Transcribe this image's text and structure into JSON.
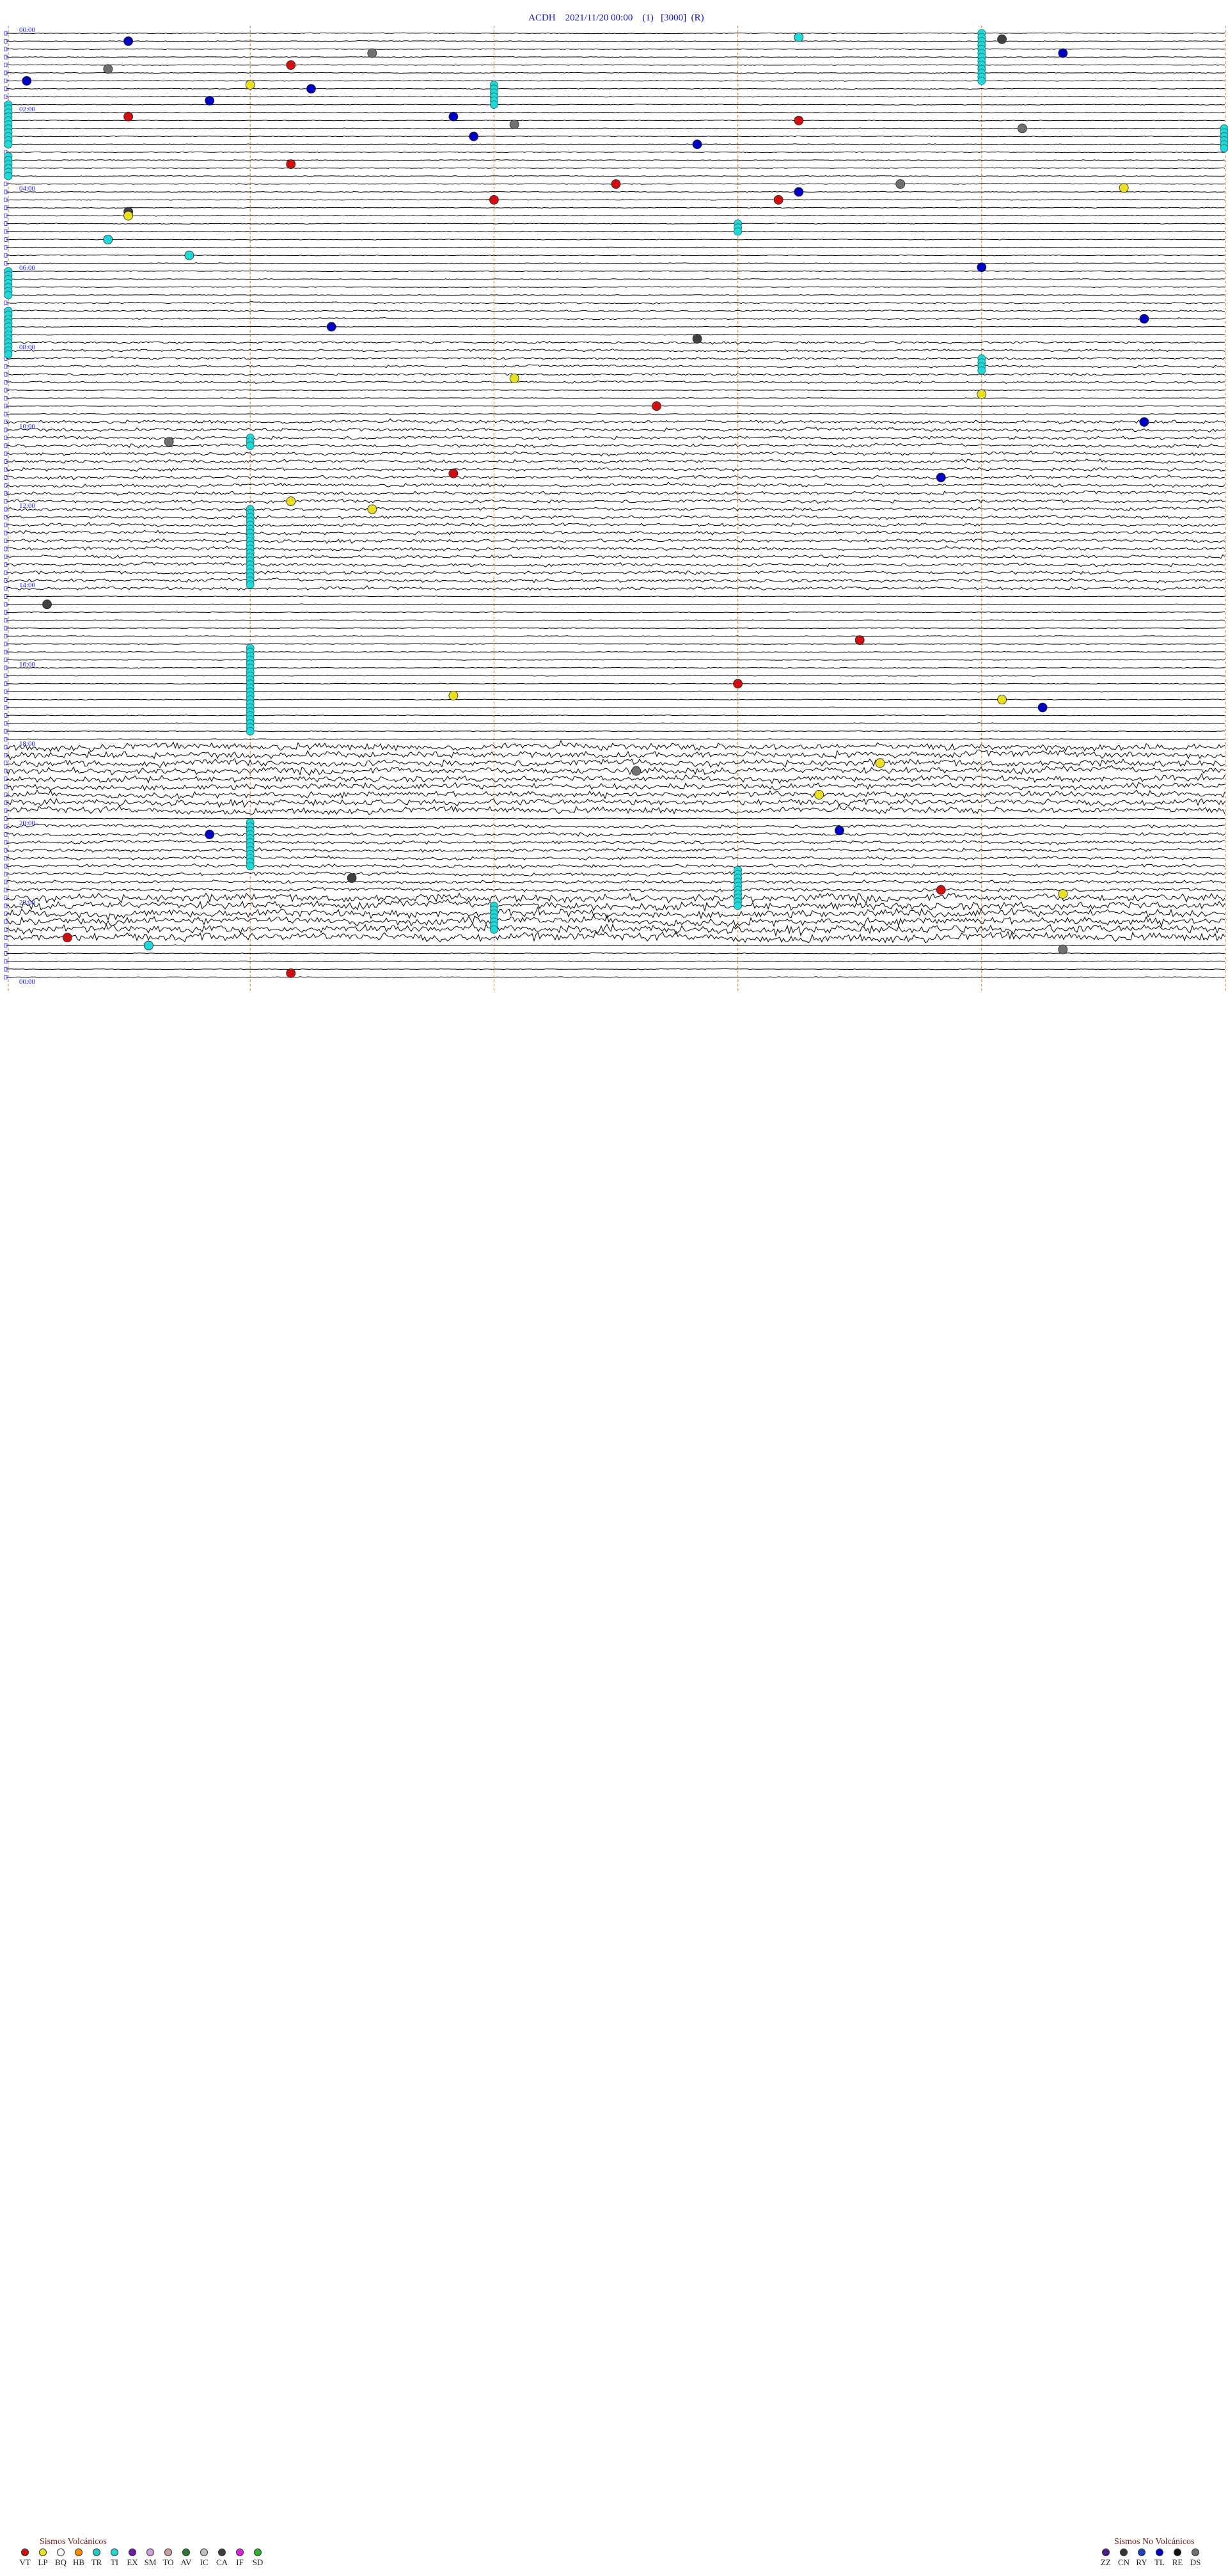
{
  "header": {
    "station": "ACDH",
    "datetime": "2021/11/20 00:00",
    "param1": "(1)",
    "param2": "[3000]",
    "param3": "(R)"
  },
  "chart_data": {
    "type": "helicorder",
    "rows_per_hour": 5,
    "hours_shown": 24,
    "hour_labels": [
      "00:00",
      "02:00",
      "04:00",
      "06:00",
      "08:00",
      "10:00",
      "12:00",
      "14:00",
      "16:00",
      "18:00",
      "20:00",
      "22:00",
      "00:00"
    ],
    "colors": {
      "trace": "#000000",
      "label": "#1a1aff",
      "gridline": "#d98c5f",
      "VT": "#d01010",
      "LP": "#e8e020",
      "BQ": "#ffffff",
      "HB": "#ff8c00",
      "TR": "#20c8c8",
      "TI": "#20d8d8",
      "EX": "#6a1ab0",
      "SM": "#d0a0e0",
      "TO": "#c8a0a0",
      "AV": "#2a7a2a",
      "IC": "#c0c0c0",
      "CA": "#404040",
      "IF": "#e020e0",
      "SD": "#30b030",
      "ZZ": "#4b1d8a",
      "CN": "#333333",
      "RY": "#2040c0",
      "TL": "#0000c0",
      "RE": "#101010",
      "DS": "#707070"
    },
    "events": [
      {
        "hour": 0.2,
        "minute": 6,
        "class": "TL"
      },
      {
        "hour": 0.1,
        "minute": 39,
        "class": "TI"
      },
      {
        "hour": 0.15,
        "minute": 49,
        "class": "CA"
      },
      {
        "hour": 0.5,
        "minute": 18,
        "class": "DS"
      },
      {
        "hour": 0.5,
        "minute": 52,
        "class": "TL"
      },
      {
        "hour": 0.8,
        "minute": 14,
        "class": "VT"
      },
      {
        "hour": 0.9,
        "minute": 5,
        "class": "DS"
      },
      {
        "hour": 1.2,
        "minute": 1,
        "class": "TL"
      },
      {
        "hour": 1.3,
        "minute": 12,
        "class": "LP"
      },
      {
        "hour": 1.4,
        "minute": 15,
        "class": "TL"
      },
      {
        "hour": 1.7,
        "minute": 10,
        "class": "TL"
      },
      {
        "hour": 2.1,
        "minute": 6,
        "class": "VT"
      },
      {
        "hour": 2.1,
        "minute": 22,
        "class": "TL"
      },
      {
        "hour": 2.2,
        "minute": 39,
        "class": "VT"
      },
      {
        "hour": 2.3,
        "minute": 25,
        "class": "DS"
      },
      {
        "hour": 2.4,
        "minute": 50,
        "class": "DS"
      },
      {
        "hour": 2.6,
        "minute": 23,
        "class": "TL"
      },
      {
        "hour": 2.8,
        "minute": 34,
        "class": "TL"
      },
      {
        "hour": 3.3,
        "minute": 14,
        "class": "VT"
      },
      {
        "hour": 3.8,
        "minute": 30,
        "class": "VT"
      },
      {
        "hour": 3.8,
        "minute": 44,
        "class": "DS"
      },
      {
        "hour": 3.9,
        "minute": 55,
        "class": "LP"
      },
      {
        "hour": 4.0,
        "minute": 39,
        "class": "TL"
      },
      {
        "hour": 4.2,
        "minute": 24,
        "class": "VT"
      },
      {
        "hour": 4.2,
        "minute": 38,
        "class": "VT"
      },
      {
        "hour": 4.5,
        "minute": 6,
        "class": "CA"
      },
      {
        "hour": 4.6,
        "minute": 6,
        "class": "LP"
      },
      {
        "hour": 5.2,
        "minute": 5,
        "class": "TI"
      },
      {
        "hour": 5.6,
        "minute": 9,
        "class": "TI"
      },
      {
        "hour": 5.9,
        "minute": 48,
        "class": "TL"
      },
      {
        "hour": 7.2,
        "minute": 56,
        "class": "TL"
      },
      {
        "hour": 7.4,
        "minute": 16,
        "class": "TL"
      },
      {
        "hour": 7.7,
        "minute": 34,
        "class": "CA"
      },
      {
        "hour": 8.7,
        "minute": 25,
        "class": "LP"
      },
      {
        "hour": 9.1,
        "minute": 48,
        "class": "LP"
      },
      {
        "hour": 9.4,
        "minute": 32,
        "class": "VT"
      },
      {
        "hour": 9.8,
        "minute": 56,
        "class": "TL"
      },
      {
        "hour": 10.3,
        "minute": 8,
        "class": "DS"
      },
      {
        "hour": 11.1,
        "minute": 22,
        "class": "VT"
      },
      {
        "hour": 11.2,
        "minute": 46,
        "class": "TL"
      },
      {
        "hour": 11.8,
        "minute": 14,
        "class": "LP"
      },
      {
        "hour": 12.0,
        "minute": 18,
        "class": "LP"
      },
      {
        "hour": 14.4,
        "minute": 2,
        "class": "CA"
      },
      {
        "hour": 15.3,
        "minute": 42,
        "class": "VT"
      },
      {
        "hour": 16.4,
        "minute": 36,
        "class": "VT"
      },
      {
        "hour": 16.7,
        "minute": 22,
        "class": "LP"
      },
      {
        "hour": 16.8,
        "minute": 49,
        "class": "LP"
      },
      {
        "hour": 17.0,
        "minute": 51,
        "class": "TL"
      },
      {
        "hour": 18.4,
        "minute": 43,
        "class": "LP"
      },
      {
        "hour": 18.6,
        "minute": 31,
        "class": "DS"
      },
      {
        "hour": 19.2,
        "minute": 40,
        "class": "LP"
      },
      {
        "hour": 20.2,
        "minute": 10,
        "class": "TL"
      },
      {
        "hour": 20.1,
        "minute": 41,
        "class": "TL"
      },
      {
        "hour": 21.3,
        "minute": 17,
        "class": "CA"
      },
      {
        "hour": 21.6,
        "minute": 46,
        "class": "VT"
      },
      {
        "hour": 21.7,
        "minute": 52,
        "class": "LP"
      },
      {
        "hour": 22.8,
        "minute": 3,
        "class": "VT"
      },
      {
        "hour": 23.0,
        "minute": 7,
        "class": "TI"
      },
      {
        "hour": 23.1,
        "minute": 52,
        "class": "DS"
      },
      {
        "hour": 23.7,
        "minute": 14,
        "class": "VT"
      }
    ],
    "ti_columns": [
      {
        "minute": 48,
        "from_hour": 0.0,
        "to_hour": 1.2
      },
      {
        "minute": 24,
        "from_hour": 1.3,
        "to_hour": 1.8
      },
      {
        "minute": 0,
        "from_hour": 1.8,
        "to_hour": 2.8
      },
      {
        "minute": 60,
        "from_hour": 2.4,
        "to_hour": 2.9
      },
      {
        "minute": 0,
        "from_hour": 3.1,
        "to_hour": 3.6
      },
      {
        "minute": 36,
        "from_hour": 4.8,
        "to_hour": 5.0
      },
      {
        "minute": 0,
        "from_hour": 6.0,
        "to_hour": 6.6
      },
      {
        "minute": 0,
        "from_hour": 7.0,
        "to_hour": 8.1
      },
      {
        "minute": 48,
        "from_hour": 8.2,
        "to_hour": 8.5
      },
      {
        "minute": 12,
        "from_hour": 10.2,
        "to_hour": 10.4
      },
      {
        "minute": 12,
        "from_hour": 12.0,
        "to_hour": 13.9
      },
      {
        "minute": 12,
        "from_hour": 15.5,
        "to_hour": 17.6
      },
      {
        "minute": 12,
        "from_hour": 19.9,
        "to_hour": 21.0
      },
      {
        "minute": 36,
        "from_hour": 21.1,
        "to_hour": 22.0
      },
      {
        "minute": 24,
        "from_hour": 22.0,
        "to_hour": 22.6
      }
    ],
    "noisy_bands": [
      {
        "from_hour": 6.8,
        "to_hour": 7.2,
        "level": 1.2
      },
      {
        "from_hour": 7.8,
        "to_hour": 8.9,
        "level": 1.6
      },
      {
        "from_hour": 9.8,
        "to_hour": 14.0,
        "level": 2.4
      },
      {
        "from_hour": 17.9,
        "to_hour": 18.7,
        "level": 5.0
      },
      {
        "from_hour": 18.8,
        "to_hour": 19.7,
        "level": 4.6
      },
      {
        "from_hour": 20.0,
        "to_hour": 21.7,
        "level": 2.4
      },
      {
        "from_hour": 21.8,
        "to_hour": 22.9,
        "level": 6.0
      }
    ]
  },
  "legend": {
    "volcanic_title": "Sismos Volcánicos",
    "volcanic": [
      {
        "code": "VT",
        "color": "#d01010"
      },
      {
        "code": "LP",
        "color": "#e8e020"
      },
      {
        "code": "BQ",
        "color": "#ffffff"
      },
      {
        "code": "HB",
        "color": "#ff8c00"
      },
      {
        "code": "TR",
        "color": "#20c8c8"
      },
      {
        "code": "TI",
        "color": "#20d8d8"
      },
      {
        "code": "EX",
        "color": "#6a1ab0"
      },
      {
        "code": "SM",
        "color": "#d0a0e0"
      },
      {
        "code": "TO",
        "color": "#c8a0a0"
      },
      {
        "code": "AV",
        "color": "#2a7a2a"
      },
      {
        "code": "IC",
        "color": "#c0c0c0"
      },
      {
        "code": "CA",
        "color": "#404040"
      },
      {
        "code": "IF",
        "color": "#e020e0"
      },
      {
        "code": "SD",
        "color": "#30b030"
      }
    ],
    "nonvolcanic_title": "Sismos No Volcánicos",
    "nonvolcanic": [
      {
        "code": "ZZ",
        "color": "#4b1d8a"
      },
      {
        "code": "CN",
        "color": "#333333"
      },
      {
        "code": "RY",
        "color": "#2040c0"
      },
      {
        "code": "TL",
        "color": "#0000c0"
      },
      {
        "code": "RE",
        "color": "#101010"
      },
      {
        "code": "DS",
        "color": "#707070"
      }
    ]
  }
}
